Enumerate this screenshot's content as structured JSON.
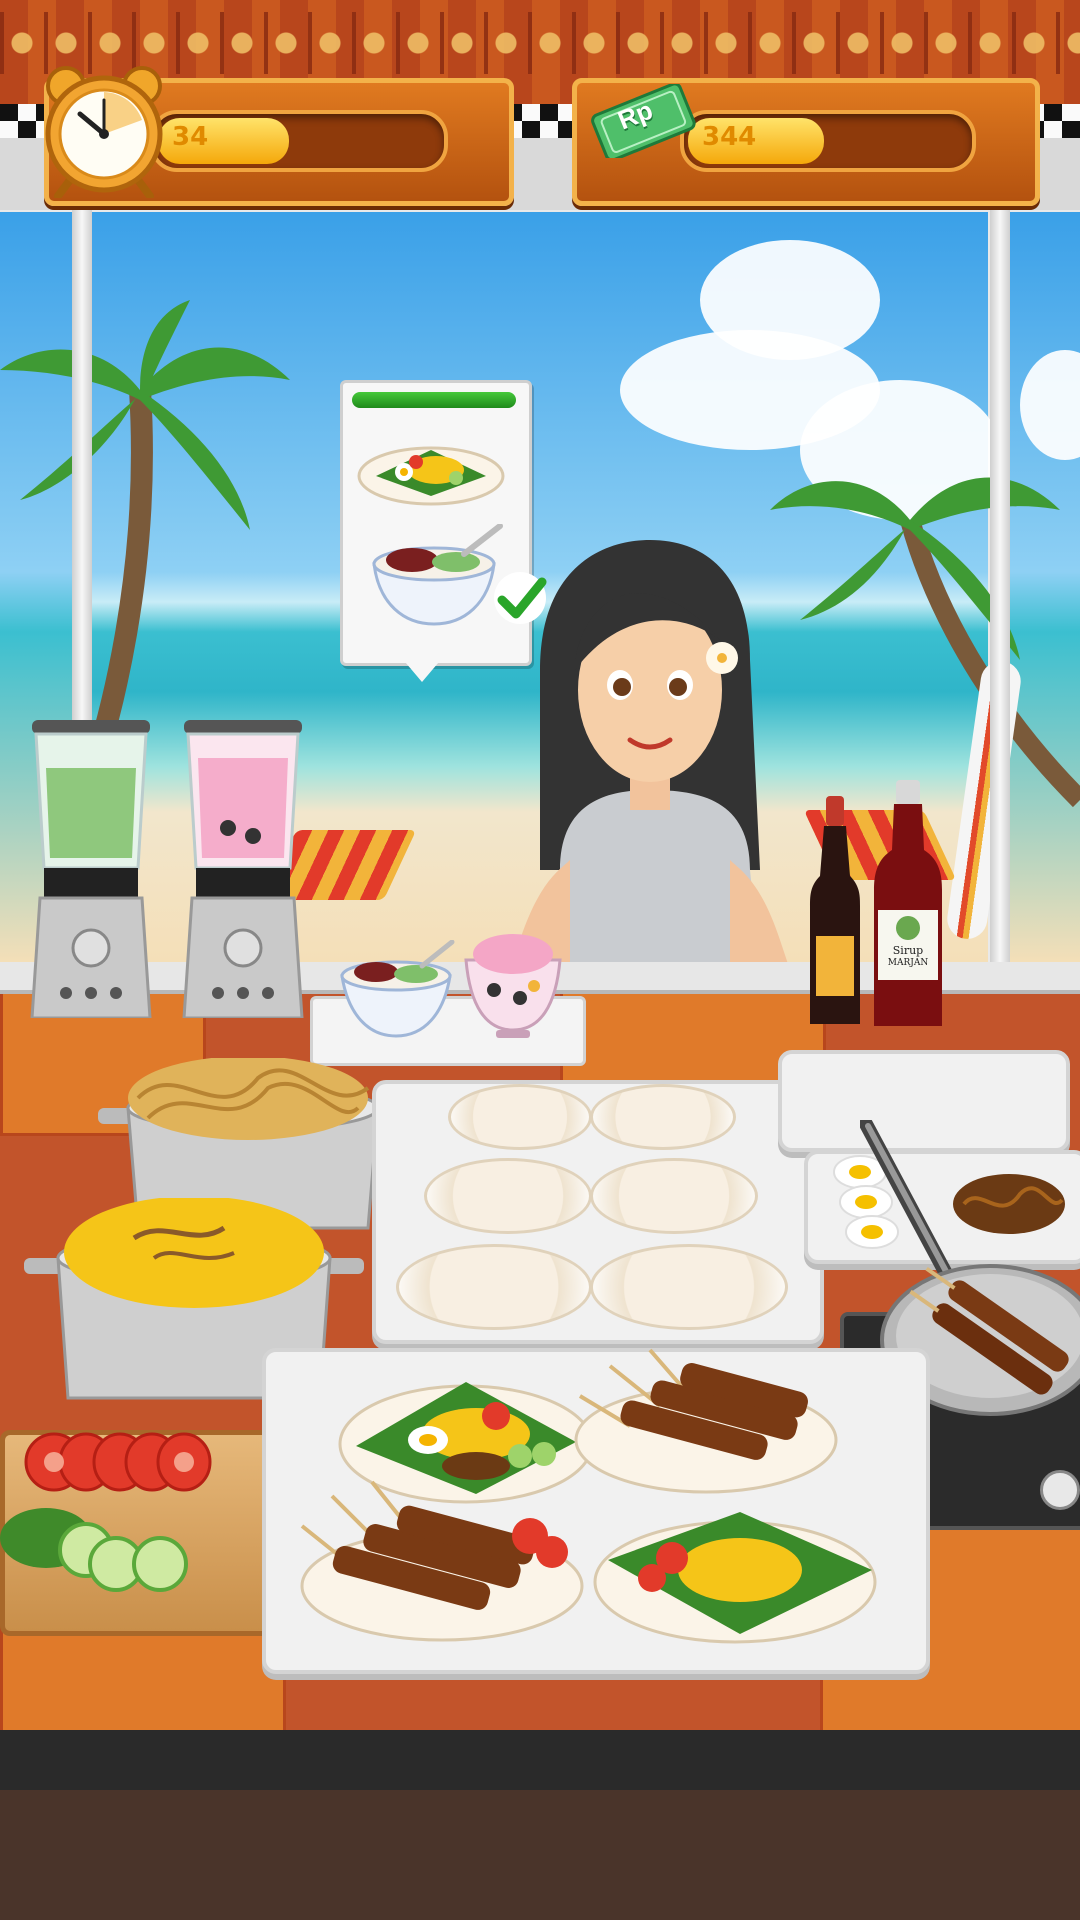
{
  "hud": {
    "timer": {
      "icon": "alarm-clock-icon",
      "value": "34",
      "fill_fraction": 0.48
    },
    "money": {
      "icon": "rupiah-banknote-icon",
      "currency_symbol": "Rp",
      "value": "344",
      "fill_fraction": 0.5
    }
  },
  "order": {
    "items": [
      "nasi-kuning-plate-icon",
      "es-cendol-bowl-icon"
    ],
    "patience_fraction": 1.0,
    "ready_icon": "checkmark-icon"
  },
  "station": {
    "syrup_bottle": {
      "line1": "Sirup",
      "line2": "MARJAN"
    }
  },
  "colors": {
    "hud_bar": "#8e3a0b",
    "hud_fill": "#f5a80a",
    "counter": "#c2542b",
    "patience": "#45c93a"
  }
}
